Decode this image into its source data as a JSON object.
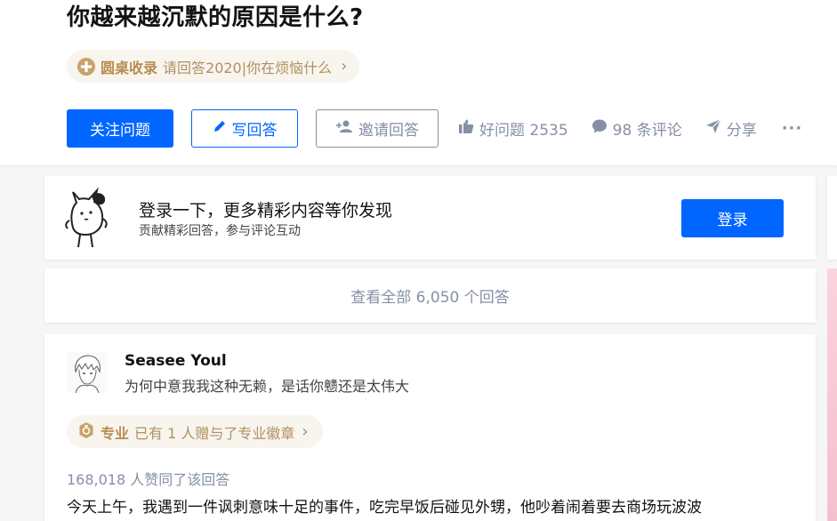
{
  "question": {
    "title": "你越来越沉默的原因是什么?",
    "roundtable": {
      "name": "圆桌收录",
      "subtitle": "请回答2020|你在烦恼什么"
    }
  },
  "actions": {
    "follow_label": "关注问题",
    "answer_label": "写回答",
    "invite_label": "邀请回答",
    "good_question": "好问题 2535",
    "comments": "98 条评论",
    "share": "分享",
    "more": "···"
  },
  "login_prompt": {
    "title": "登录一下，更多精彩内容等你发现",
    "subtitle": "贡献精彩回答，参与评论互动",
    "button": "登录"
  },
  "view_all": "查看全部 6,050 个回答",
  "answer": {
    "author": "Seasee Youl",
    "bio": "为何中意我我这种无赖，是话你戆还是太伟大",
    "badge_name": "专业",
    "badge_text": "已有 1 人赠与了专业徽章",
    "votes": "168,018 人赞同了该回答",
    "content": "今天上午，我遇到一件讽刺意味十足的事件，吃完早饭后碰见外甥，他吵着闹着要去商场玩波波"
  },
  "colors": {
    "primary": "#0066ff",
    "muted": "#8590a6",
    "gold": "#b78d4e"
  },
  "icons": [
    "roundtable-icon",
    "chevron-right-icon",
    "pen-icon",
    "add-user-icon",
    "thumb-up-icon",
    "comment-icon",
    "share-icon",
    "more-icon",
    "mascot-icon",
    "badge-icon"
  ]
}
